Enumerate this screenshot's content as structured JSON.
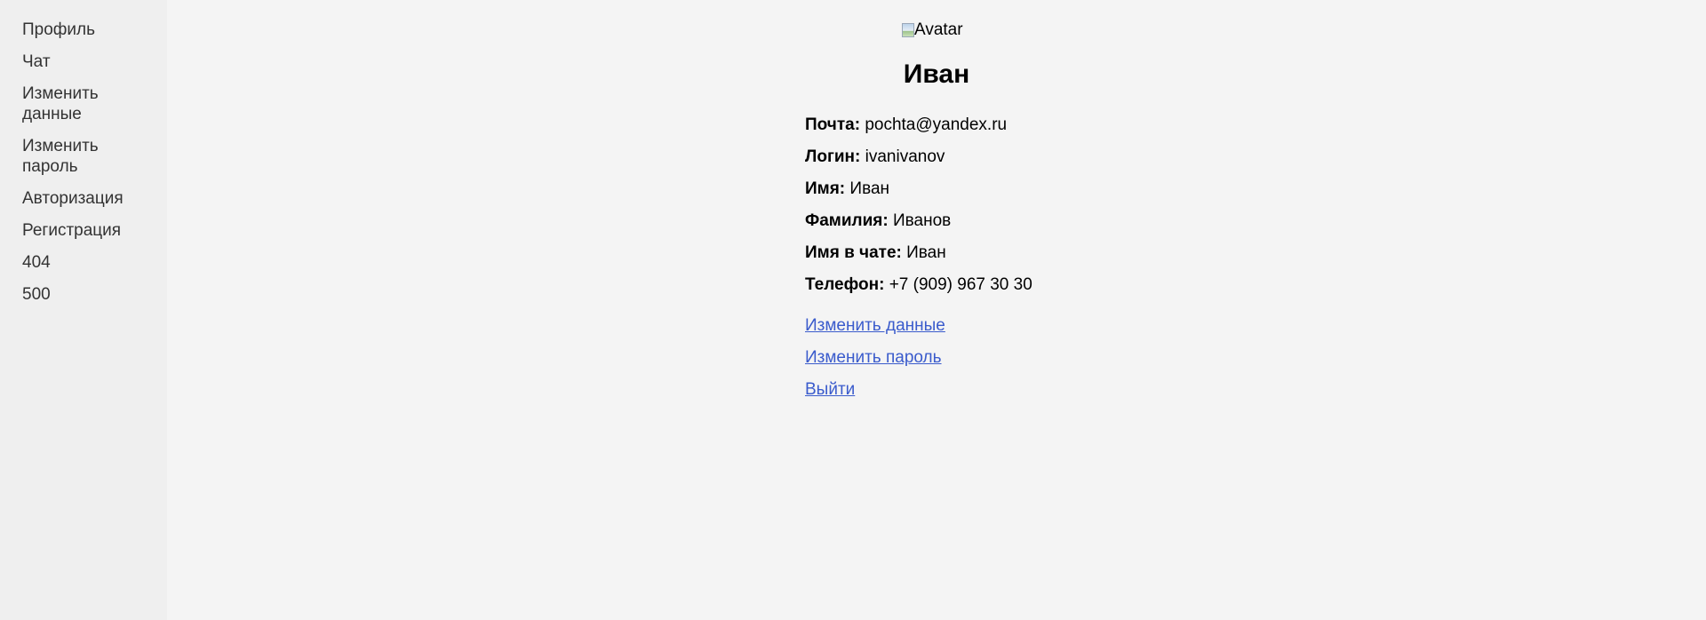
{
  "sidebar": {
    "items": [
      {
        "label": "Профиль"
      },
      {
        "label": "Чат"
      },
      {
        "label": "Изменить данные"
      },
      {
        "label": "Изменить пароль"
      },
      {
        "label": "Авторизация"
      },
      {
        "label": "Регистрация"
      },
      {
        "label": "404"
      },
      {
        "label": "500"
      }
    ]
  },
  "profile": {
    "avatar_alt": "Avatar",
    "name": "Иван",
    "fields": [
      {
        "label": "Почта:",
        "value": "pochta@yandex.ru"
      },
      {
        "label": "Логин:",
        "value": "ivanivanov"
      },
      {
        "label": "Имя:",
        "value": "Иван"
      },
      {
        "label": "Фамилия:",
        "value": "Иванов"
      },
      {
        "label": "Имя в чате:",
        "value": "Иван"
      },
      {
        "label": "Телефон:",
        "value": "+7 (909) 967 30 30"
      }
    ],
    "actions": {
      "edit_data": "Изменить данные",
      "edit_password": "Изменить пароль",
      "logout": "Выйти"
    }
  },
  "colors": {
    "page_background": "#f4f4f4",
    "sidebar_background": "#efefef",
    "link": "#3a5bcc"
  }
}
